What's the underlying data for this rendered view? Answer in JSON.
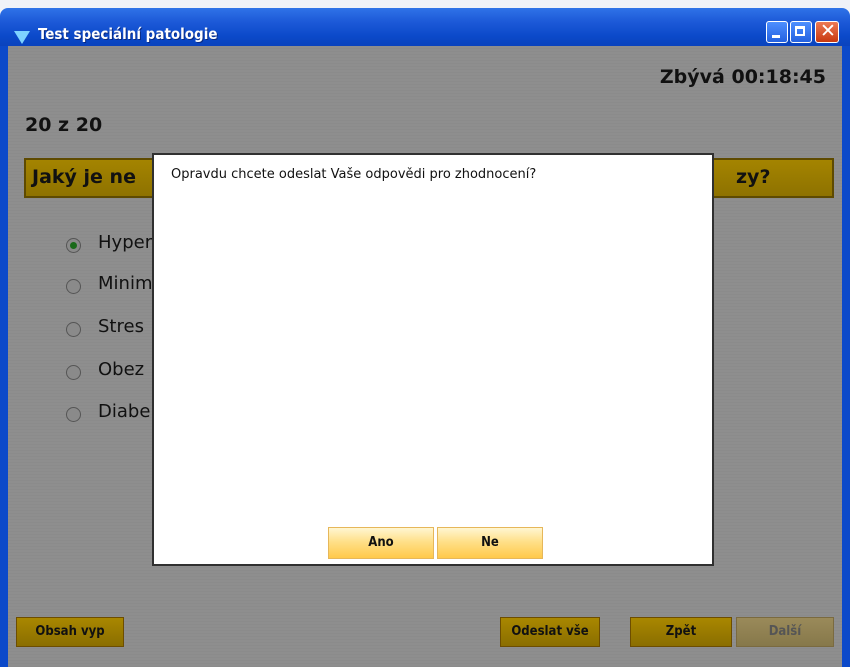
{
  "window": {
    "title": "Test speciální patologie",
    "minimize_icon": "minimize-icon",
    "maximize_icon": "maximize-icon",
    "close_icon": "close-icon"
  },
  "quiz": {
    "timer": "Zbývá 00:18:45",
    "progress": "20 z 20",
    "question_visible_left": "Jaký je ne",
    "question_visible_right": "zy?",
    "options": [
      {
        "label": "Hyper",
        "selected": true
      },
      {
        "label": "Minim",
        "selected": false
      },
      {
        "label": "Stres",
        "selected": false
      },
      {
        "label": "Obez",
        "selected": false
      },
      {
        "label": "Diabe",
        "selected": false
      }
    ]
  },
  "footer": {
    "contents_button": "Obsah vyp",
    "submit_all_button": "Odeslat vše",
    "back_button": "Zpět",
    "next_button": "Další"
  },
  "dialog": {
    "message": "Opravdu chcete odeslat Vaše odpovědi pro zhodnocení?",
    "yes_button": "Ano",
    "no_button": "Ne"
  },
  "colors": {
    "titlebar": "#0b49c9",
    "question_bar": "#9a7c00",
    "dialog_button": "#ffd060"
  }
}
